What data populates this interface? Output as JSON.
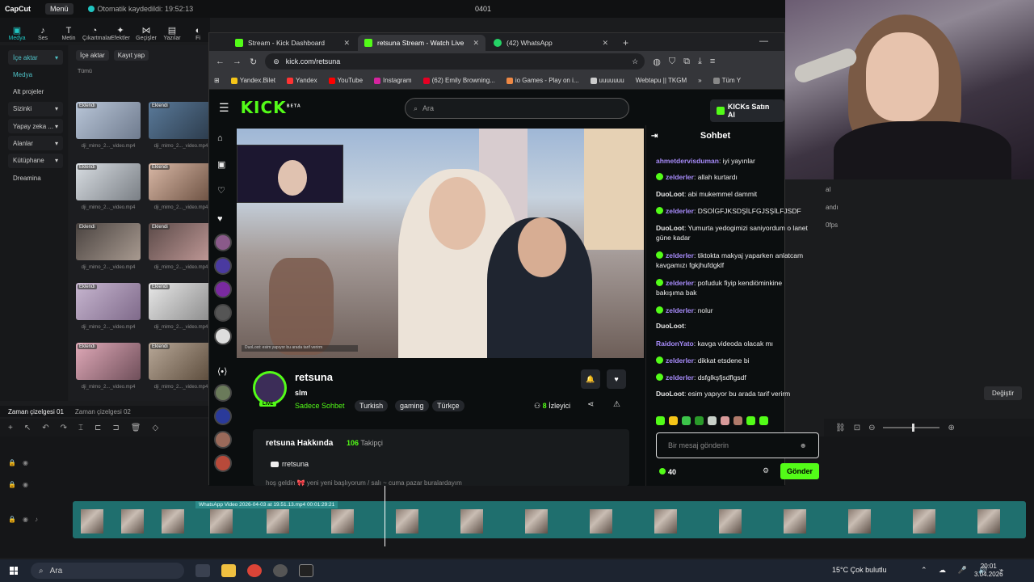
{
  "capcut": {
    "logo": "CapCut",
    "menu": "Menü",
    "autosave": "Otomatik kaydedildi: 19:52:13",
    "project_title": "0401",
    "toolbar": [
      "Medya",
      "Ses",
      "Metin",
      "Çıkartmalar",
      "Efektler",
      "Geçişler",
      "Yazılar",
      "Fi"
    ],
    "sidebar": [
      {
        "label": "İçe aktar"
      },
      {
        "label": "Medya"
      },
      {
        "label": "Alt projeler"
      },
      {
        "label": "Sizinki"
      },
      {
        "label": "Yapay zeka ..."
      },
      {
        "label": "Alanlar"
      },
      {
        "label": "Kütüphane"
      },
      {
        "label": "Dreamina"
      }
    ],
    "media_head": {
      "import": "İçe aktar",
      "record": "Kayıt yap"
    },
    "all_label": "Tümü",
    "thumb_badge": "Eklendi",
    "thumb_caption_1": "dji_mimo_2..._video.mp4",
    "thumb_caption_2": "dji_mimo_2..._video.mp4",
    "timeline_tabs": [
      "Zaman çizelgesi 01",
      "Zaman çizelgesi 02"
    ],
    "clip_label": "WhatsApp Video 2026-04-03 at 19.51.13.mp4   00:01:29:21",
    "right_button": "Değiştir",
    "right_labels": [
      "al",
      "andı",
      "0fps"
    ]
  },
  "browser": {
    "tabs": [
      {
        "label": "Stream - Kick Dashboard"
      },
      {
        "label": "retsuna Stream - Watch Live"
      },
      {
        "label": "(42) WhatsApp"
      }
    ],
    "url": "kick.com/retsuna",
    "bookmarks": [
      "Yandex.Bilet",
      "Yandex",
      "YouTube",
      "Instagram",
      "(62) Emily Browning...",
      "io Games - Play on i...",
      "uuuuuuu",
      "Webtapu || TKGM"
    ],
    "bookmarks_more": "Tüm Y"
  },
  "kick": {
    "logo": "KICK",
    "logo_badge": "BETA",
    "search_placeholder": "Ara",
    "buy_button": "KICKs Satın Al",
    "streamer": {
      "name": "retsuna",
      "title": "slm",
      "category": "Sadece Sohbet",
      "tags": [
        "Turkish",
        "gaming",
        "Türkçe"
      ],
      "viewers_count": "8",
      "viewers_label": "İzleyici",
      "live": "LIVE"
    },
    "about": {
      "title": "retsuna Hakkında",
      "followers": "106",
      "followers_label": "Takipçi",
      "youtube": "rretsuna",
      "bio": "hoş geldin 🎀 yeni yeni başlıyorum / salı ~ cuma pazar buralardayım"
    },
    "chat": {
      "header": "Sohbet",
      "messages": [
        {
          "user": "ahmetdervisduman",
          "text": ": iyi yayınlar",
          "color": "#a78bfa",
          "badge": false
        },
        {
          "user": "zelderler",
          "text": ": allah kurtardı",
          "color": "#a78bfa",
          "badge": true
        },
        {
          "user": "DuoLoot",
          "text": ": abi mukemmel dammit",
          "color": "#e8e8e8",
          "badge": false
        },
        {
          "user": "zelderler",
          "text": ": DSOİGFJKSDŞİLFGJSŞİLFJSDF",
          "color": "#a78bfa",
          "badge": true
        },
        {
          "user": "DuoLoot",
          "text": ": Yumurta yedogimizi saniyordum o lanet güne kadar",
          "color": "#e8e8e8",
          "badge": false
        },
        {
          "user": "zelderler",
          "text": ": tiktokta makyaj yaparken anlatcam kavgamızı fgkjhufdgklf",
          "color": "#a78bfa",
          "badge": true
        },
        {
          "user": "zelderler",
          "text": ": pofuduk fiyip kendiöminkine bakışıma bak",
          "color": "#a78bfa",
          "badge": true
        },
        {
          "user": "zelderler",
          "text": ": nolur",
          "color": "#a78bfa",
          "badge": true
        },
        {
          "user": "DuoLoot",
          "text": ":",
          "color": "#e8e8e8",
          "badge": false
        },
        {
          "user": "RaidonYato",
          "text": ": kavga videoda olacak mı",
          "color": "#a78bfa",
          "badge": false
        },
        {
          "user": "zelderler",
          "text": ": dikkat etsdene bi",
          "color": "#a78bfa",
          "badge": true
        },
        {
          "user": "zelderler",
          "text": ": dsfglkşfjsdflgsdf",
          "color": "#a78bfa",
          "badge": true
        },
        {
          "user": "DuoLoot",
          "text": ": esim yapıyor bu arada tarif verirm",
          "color": "#e8e8e8",
          "badge": false
        }
      ],
      "input_placeholder": "Bir mesaj gönderin",
      "points": "40",
      "send": "Gönder"
    },
    "video_caption": "DuoLoot: esim yapıyor bu arada tarif verirm"
  },
  "taskbar": {
    "search": "Ara",
    "weather": "15°C  Çok bulutlu",
    "time": "20:01",
    "date": "3.04.2026"
  },
  "colors": {
    "kick_green": "#53fc18",
    "capcut_teal": "#20c4c0",
    "clip": "#1f6f6e"
  }
}
